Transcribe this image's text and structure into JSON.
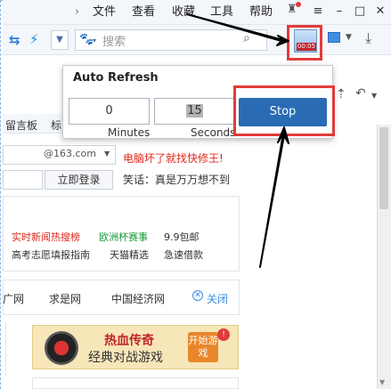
{
  "menubar": {
    "items": [
      "文件",
      "查看",
      "收藏",
      "工具",
      "帮助"
    ],
    "window_controls": [
      "–",
      "□",
      "✕"
    ]
  },
  "toolbar": {
    "search_placeholder": "搜索",
    "extension_timer": "00:05"
  },
  "tabbar": {
    "items": [
      "留言板",
      "标"
    ]
  },
  "popup": {
    "title": "Auto Refresh",
    "minutes_value": "0",
    "seconds_value": "15",
    "minutes_label": "Minutes",
    "seconds_label": "Seconds",
    "stop_label": "Stop"
  },
  "login": {
    "email_domain": "@163.com",
    "login_button": "立即登录",
    "promo": "电脑坏了就找快修王!",
    "joke": "笑话：真是万万想不到"
  },
  "news": {
    "row1": [
      "实时新闻热搜榜",
      "欧洲杯赛事",
      "9.9包邮"
    ],
    "row2": [
      "高考志愿填报指南",
      "天猫精选",
      "急速借款"
    ]
  },
  "links": {
    "items": [
      "广网",
      "求是网",
      "中国经济网"
    ],
    "close_label": "关闭"
  },
  "ad": {
    "line1": "热血传奇",
    "line2": "经典对战游戏",
    "button": "开始游戏"
  },
  "colors": {
    "highlight_red": "#e23b3b",
    "stop_blue": "#2a6bb5",
    "link_red": "#e0281c",
    "link_green": "#169b3a"
  }
}
